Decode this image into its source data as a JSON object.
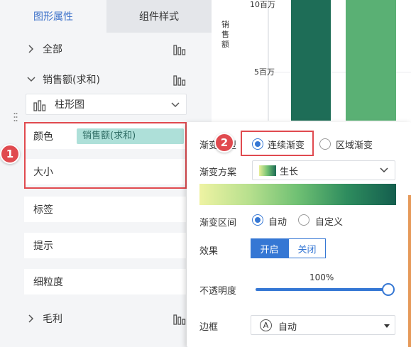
{
  "tabs": [
    {
      "label": "图形属性",
      "active": true
    },
    {
      "label": "组件样式",
      "active": false
    }
  ],
  "tree": {
    "all_label": "全部",
    "sales_label": "销售额(求和)",
    "chart_type": "柱形图",
    "profit_label": "毛利"
  },
  "cards": {
    "color_label": "颜色",
    "color_field": "销售额(求和)",
    "size_label": "大小",
    "tag_label": "标签",
    "tip_label": "提示",
    "granularity_label": "细粒度"
  },
  "badges": {
    "one": "1",
    "two": "2"
  },
  "chart": {
    "y_title_chars": [
      "销",
      "售",
      "额"
    ],
    "ticks": [
      "10百万",
      "5百万"
    ],
    "bar_colors": [
      "#1e6d57",
      "#5ab074"
    ]
  },
  "popover": {
    "gradient_type_label": "渐变类型",
    "gradient_type_options": [
      "连续渐变",
      "区域渐变"
    ],
    "gradient_type_selected": "连续渐变",
    "scheme_label": "渐变方案",
    "scheme_value": "生长",
    "range_label": "渐变区间",
    "range_options": [
      "自动",
      "自定义"
    ],
    "range_selected": "自动",
    "effect_label": "效果",
    "effect_on": "开启",
    "effect_off": "关闭",
    "effect_selected": "开启",
    "opacity_label": "不透明度",
    "opacity_value": "100%",
    "opacity_fraction": 1.0,
    "border_label": "边框",
    "border_icon_letter": "A",
    "border_value": "自动"
  },
  "colors": {
    "accent": "#3577d4",
    "highlight_red": "#e04a4f",
    "pill_bg": "#aee0d9"
  }
}
